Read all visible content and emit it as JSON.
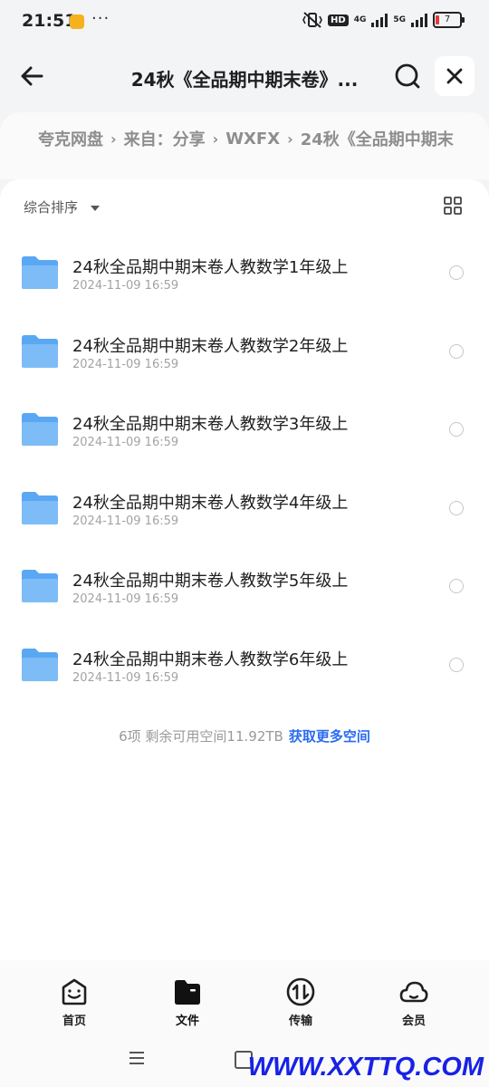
{
  "status_bar": {
    "time": "21:51",
    "dots": "···",
    "hd": "HD",
    "net1": "4G",
    "net2": "5G",
    "battery": "7"
  },
  "header": {
    "title": "24秋《全品期中期末卷》..."
  },
  "breadcrumb": [
    "夸克网盘",
    "来自：分享",
    "WXFX",
    "24秋《全品期中期末"
  ],
  "sort": {
    "label": "综合排序"
  },
  "files": [
    {
      "name": "24秋全品期中期末卷人教数学1年级上",
      "date": "2024-11-09 16:59"
    },
    {
      "name": "24秋全品期中期末卷人教数学2年级上",
      "date": "2024-11-09 16:59"
    },
    {
      "name": "24秋全品期中期末卷人教数学3年级上",
      "date": "2024-11-09 16:59"
    },
    {
      "name": "24秋全品期中期末卷人教数学4年级上",
      "date": "2024-11-09 16:59"
    },
    {
      "name": "24秋全品期中期末卷人教数学5年级上",
      "date": "2024-11-09 16:59"
    },
    {
      "name": "24秋全品期中期末卷人教数学6年级上",
      "date": "2024-11-09 16:59"
    }
  ],
  "footer": {
    "info": "6项 剩余可用空间11.92TB",
    "link": "获取更多空间"
  },
  "nav": {
    "home": "首页",
    "files": "文件",
    "transfer": "传输",
    "member": "会员"
  },
  "watermark": "WWW.XXTTQ.COM",
  "colors": {
    "accent": "#2b6cf0",
    "folder": "#5aa8f3",
    "watermark": "#1822e6"
  }
}
